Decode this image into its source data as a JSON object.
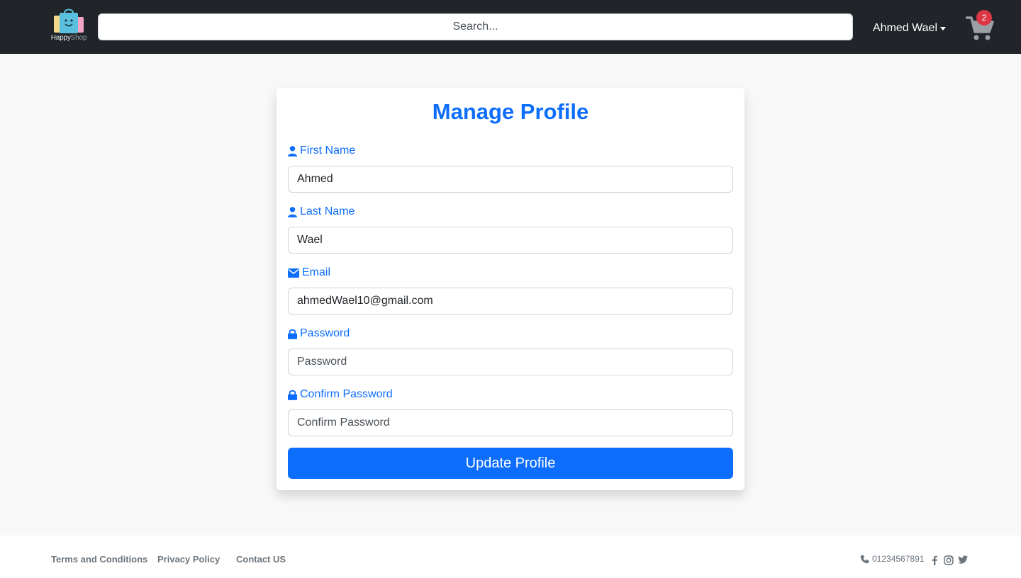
{
  "header": {
    "logo_word1": "Happy",
    "logo_word2": "Shop",
    "search_placeholder": "Search...",
    "user_name": "Ahmed Wael",
    "cart_count": "2"
  },
  "form": {
    "title": "Manage Profile",
    "first_name_label": "First Name",
    "first_name_value": "Ahmed",
    "last_name_label": "Last Name",
    "last_name_value": "Wael",
    "email_label": "Email",
    "email_value": "ahmedWael10@gmail.com",
    "password_label": "Password",
    "password_placeholder": "Password",
    "confirm_label": "Confirm Password",
    "confirm_placeholder": "Confirm Password",
    "submit_label": "Update Profile"
  },
  "footer": {
    "links": [
      "Terms and Conditions",
      "Privacy Policy",
      "Contact US"
    ],
    "phone": "01234567891",
    "social_icons": [
      "facebook-icon",
      "instagram-icon",
      "twitter-icon"
    ]
  },
  "colors": {
    "navbar": "#212529",
    "primary": "#0d6efd",
    "badge": "#dc3545",
    "footer_text": "#6c757d"
  }
}
